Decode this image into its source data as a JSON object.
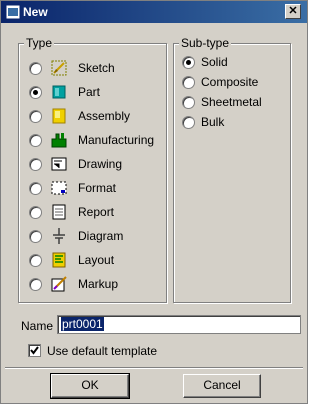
{
  "window": {
    "title": "New"
  },
  "type_group": {
    "legend": "Type",
    "items": [
      {
        "label": "Sketch",
        "icon": "sketch-icon",
        "selected": false
      },
      {
        "label": "Part",
        "icon": "part-icon",
        "selected": true
      },
      {
        "label": "Assembly",
        "icon": "assembly-icon",
        "selected": false
      },
      {
        "label": "Manufacturing",
        "icon": "manufacturing-icon",
        "selected": false
      },
      {
        "label": "Drawing",
        "icon": "drawing-icon",
        "selected": false
      },
      {
        "label": "Format",
        "icon": "format-icon",
        "selected": false
      },
      {
        "label": "Report",
        "icon": "report-icon",
        "selected": false
      },
      {
        "label": "Diagram",
        "icon": "diagram-icon",
        "selected": false
      },
      {
        "label": "Layout",
        "icon": "layout-icon",
        "selected": false
      },
      {
        "label": "Markup",
        "icon": "markup-icon",
        "selected": false
      }
    ]
  },
  "subtype_group": {
    "legend": "Sub-type",
    "items": [
      {
        "label": "Solid",
        "selected": true
      },
      {
        "label": "Composite",
        "selected": false
      },
      {
        "label": "Sheetmetal",
        "selected": false
      },
      {
        "label": "Bulk",
        "selected": false
      }
    ]
  },
  "name_field": {
    "label": "Name",
    "value": "prt0001"
  },
  "template_checkbox": {
    "label": "Use default template",
    "checked": true
  },
  "buttons": {
    "ok": "OK",
    "cancel": "Cancel"
  },
  "colors": {
    "titlebar": "#0a246a",
    "dialog_bg": "#d4d0c8",
    "selection": "#0a246a",
    "part_icon": "#00a0a0"
  }
}
